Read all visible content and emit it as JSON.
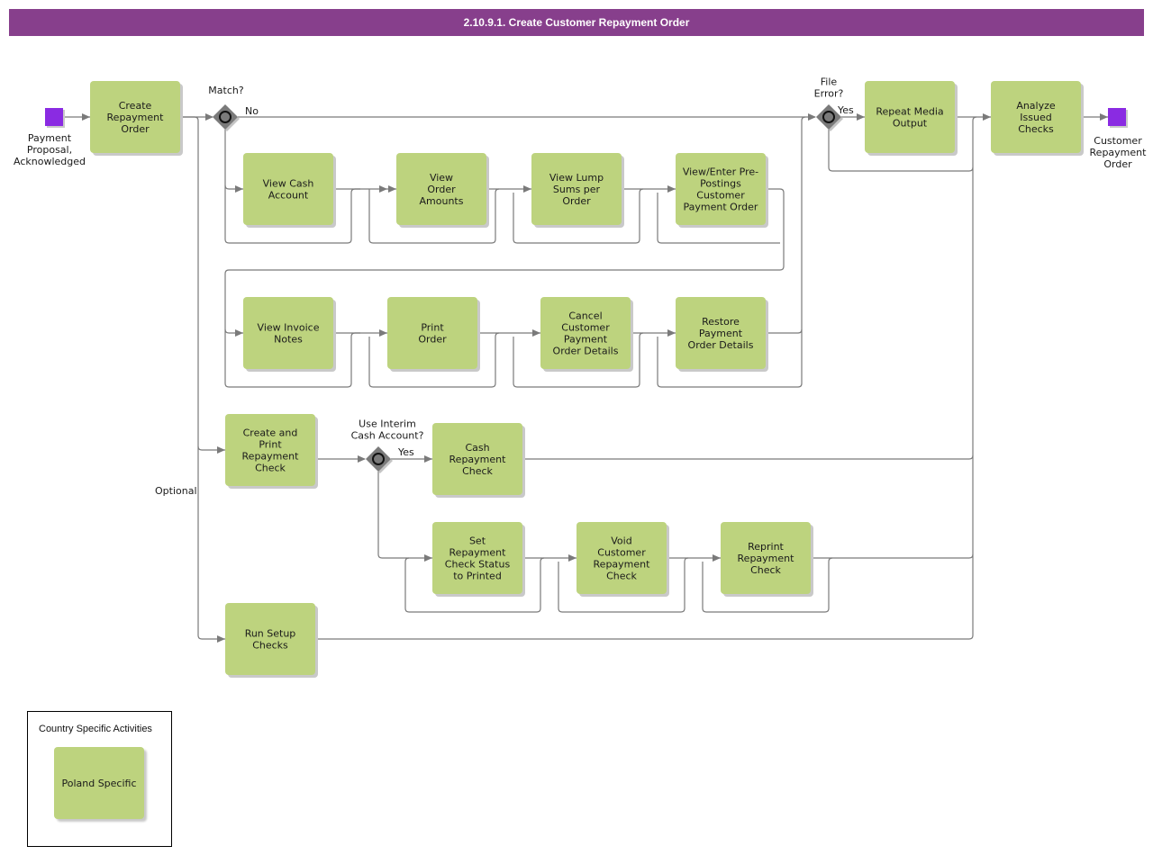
{
  "header": {
    "title": "2.10.9.1. Create Customer Repayment Order"
  },
  "colors": {
    "header_bg": "#873f8c",
    "task_fill": "#bdd37e",
    "event_fill": "#8a2be2",
    "gateway_fill": "#7a7a7a",
    "connector": "#7a7a7a"
  },
  "events": {
    "start": {
      "label": [
        "Payment",
        "Proposal,",
        "Acknowledged"
      ]
    },
    "end": {
      "label": [
        "Customer",
        "Repayment",
        "Order"
      ]
    }
  },
  "gateways": {
    "match": {
      "question": [
        "Match?"
      ],
      "branch_label": "No"
    },
    "file_error": {
      "question": [
        "File",
        "Error?"
      ],
      "branch_label": "Yes"
    },
    "interim": {
      "question": [
        "Use Interim",
        "Cash Account?"
      ],
      "branch_label": "Yes"
    }
  },
  "tasks": {
    "create_repayment_order": [
      "Create",
      "Repayment",
      "Order"
    ],
    "view_cash_account": [
      "View Cash",
      "Account"
    ],
    "view_order_amounts": [
      "View",
      "Order",
      "Amounts"
    ],
    "view_lump_sums": [
      "View Lump",
      "Sums per",
      "Order"
    ],
    "view_enter_prepostings": [
      "View/Enter Pre-",
      "Postings",
      "Customer",
      "Payment Order"
    ],
    "view_invoice_notes": [
      "View Invoice",
      "Notes"
    ],
    "print_order": [
      "Print",
      "Order"
    ],
    "cancel_payment_order_details": [
      "Cancel",
      "Customer",
      "Payment",
      "Order Details"
    ],
    "restore_payment_order_details": [
      "Restore",
      "Payment",
      "Order Details"
    ],
    "repeat_media_output": [
      "Repeat Media",
      "Output"
    ],
    "analyze_issued_checks": [
      "Analyze",
      "Issued",
      "Checks"
    ],
    "create_print_repayment_check": [
      "Create and",
      "Print",
      "Repayment",
      "Check"
    ],
    "cash_repayment_check": [
      "Cash",
      "Repayment",
      "Check"
    ],
    "set_check_status_printed": [
      "Set",
      "Repayment",
      "Check Status",
      "to Printed"
    ],
    "void_customer_repayment_check": [
      "Void",
      "Customer",
      "Repayment",
      "Check"
    ],
    "reprint_repayment_check": [
      "Reprint",
      "Repayment",
      "Check"
    ],
    "run_setup_checks": [
      "Run Setup",
      "Checks"
    ]
  },
  "annotations": {
    "optional": "Optional"
  },
  "legend": {
    "title": "Country Specific Activities",
    "item": "Poland Specific"
  }
}
